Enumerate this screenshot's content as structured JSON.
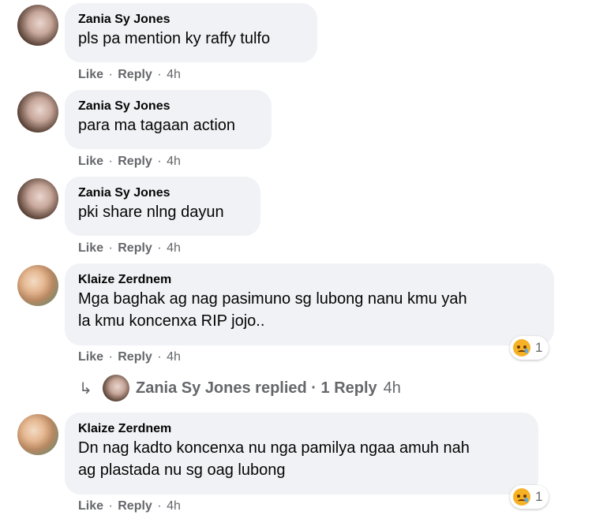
{
  "comments": [
    {
      "author": "Zania Sy Jones",
      "text": [
        "pls pa mention ky raffy tulfo"
      ],
      "like": "Like",
      "reply": "Reply",
      "time": "4h"
    },
    {
      "author": "Zania Sy Jones",
      "text": [
        "para ma tagaan action"
      ],
      "like": "Like",
      "reply": "Reply",
      "time": "4h"
    },
    {
      "author": "Zania Sy Jones",
      "text": [
        "pki share nlng dayun"
      ],
      "like": "Like",
      "reply": "Reply",
      "time": "4h"
    },
    {
      "author": "Klaize Zerdnem",
      "text": [
        "Mga baghak ag nag pasimuno sg lubong nanu kmu yah",
        "la kmu koncenxa RIP jojo.."
      ],
      "like": "Like",
      "reply": "Reply",
      "time": "4h",
      "reaction_count": "1"
    },
    {
      "author": "Klaize Zerdnem",
      "text": [
        "Dn nag kadto koncenxa nu nga pamilya ngaa amuh nah",
        "ag plastada nu sg oag lubong"
      ],
      "like": "Like",
      "reply": "Reply",
      "time": "4h",
      "reaction_count": "1"
    }
  ],
  "replies_summary": {
    "arrow": "↳",
    "text": "Zania Sy Jones replied · 1 Reply",
    "time": "4h"
  },
  "separator": "·",
  "icons": {
    "reaction": "sad-reaction-icon",
    "reply_arrow": "reply-arrow-icon"
  },
  "colors": {
    "bubble": "#f0f2f5",
    "meta": "#65676b",
    "text": "#050505"
  }
}
